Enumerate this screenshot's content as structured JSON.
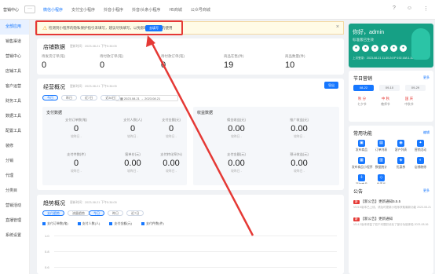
{
  "header": {
    "brand": "营销中心",
    "grid_glyph": "···",
    "nav": [
      "微信小程序",
      "支付宝小程序",
      "抖音小程序",
      "抖音/头条小程序",
      "H5商城",
      "公众号商城"
    ],
    "icons": [
      "help-icon",
      "user-icon",
      "more-icon"
    ]
  },
  "sidebar": {
    "items": [
      "全部应用",
      "销售渠道",
      "营销中心",
      "店铺工具",
      "客户运营",
      "财务工具",
      "数据工具",
      "配置工具",
      "装修",
      "分销",
      "代理",
      "分类目",
      "营销活动",
      "直播管理",
      "系统设置"
    ]
  },
  "notice": {
    "text": "检测到小程序的隐私保护指引未填写，建议尽快填写，以免影响部分功能的使用",
    "button": "去填写"
  },
  "store_data": {
    "title": "店铺数据",
    "updated": "更新时间：2023-08-21 下午5:36:05",
    "stats": [
      {
        "label": "待发货订单(笔)",
        "value": "0"
      },
      {
        "label": "待付款订单(笔)",
        "value": "0"
      },
      {
        "label": "待付款订单(笔)",
        "value": "0"
      },
      {
        "label": "商品在售(件)",
        "value": "19"
      },
      {
        "label": "商品数量(件)",
        "value": "10"
      }
    ]
  },
  "overview": {
    "title": "经营概况",
    "updated": "更新时间：2023-08-21 下午5:36:05",
    "tabs": [
      "今日",
      "昨日",
      "近7日",
      "近30日"
    ],
    "date_from": "2023.08.21",
    "date_to": "2023.08.21",
    "export": "导出",
    "pay_panel": {
      "title": "支付数据",
      "metrics": [
        {
          "label": "支付订单数(笔)",
          "value": "0",
          "compare": "较昨日 -"
        },
        {
          "label": "支付人数(人)",
          "value": "0",
          "compare": "较昨日 -"
        },
        {
          "label": "支付金额(元)",
          "value": "0",
          "compare": "较昨日 -"
        },
        {
          "label": "支付件数(件)",
          "value": "0",
          "compare": "较昨日 -"
        },
        {
          "label": "客单价(元)",
          "value": "0.00",
          "compare": "较昨日 -"
        },
        {
          "label": "支付转化率(%)",
          "value": "0.00",
          "compare": "较昨日 -"
        }
      ]
    },
    "profit_panel": {
      "title": "收益数据",
      "metrics": [
        {
          "label": "佣金收益(元)",
          "value": "0.00",
          "compare": "较昨日 -"
        },
        {
          "label": "推广收益(元)",
          "value": "0.00",
          "compare": "较昨日 -"
        },
        {
          "label": "支付金额(元)",
          "value": "0.00",
          "compare": "较昨日 -"
        },
        {
          "label": "预计收益(元)",
          "value": "0.00",
          "compare": "较昨日 -"
        }
      ]
    }
  },
  "trend": {
    "title": "趋势概况",
    "updated": "更新时间：2023-08-21 下午5:36:05",
    "modes": [
      "支付趋势",
      "流量趋势"
    ],
    "tabs": [
      "今日",
      "昨日",
      "近7日"
    ],
    "legend": [
      "支付订单数(笔)",
      "支付人数(人)",
      "支付金额(元)",
      "支付件数(件)"
    ],
    "y_ticks": [
      "1.0",
      "0.8",
      "0.6"
    ]
  },
  "profile": {
    "name": "你好，admin",
    "version": "标准版已生效",
    "meta": "上次登录：2023-08-21 11:30:24  IP:192.168.1.101"
  },
  "holiday": {
    "title": "节日营销",
    "link": "更多",
    "dates": [
      "08-22",
      "09-10",
      "09-29"
    ],
    "cells": [
      {
        "big": "秋 分",
        "small": "七夕节"
      },
      {
        "big": "中 秋",
        "small": "教师节"
      },
      {
        "big": "国 庆",
        "small": "中秋节"
      }
    ]
  },
  "functions": {
    "title": "常用功能",
    "link": "编辑",
    "items": [
      "发布商品",
      "订单列表",
      "客户列表",
      "营销活动",
      "发布商品小程序",
      "数据统计",
      "优惠券",
      "店铺装修",
      "添加商品",
      "优惠券"
    ]
  },
  "announcements": {
    "title": "公告",
    "link": "更多",
    "items": [
      {
        "tag": "新",
        "title": "【新公告】更新通知5.5.5",
        "desc": "V5.5.5版本已上线，请及时更新小程序获取最新功能 2023-08-21"
      },
      {
        "tag": "新",
        "title": "【新公告】更新通知",
        "desc": "V5.4.2版本修复了若干问题并优化了部分功能体验 2023-08-06"
      }
    ]
  }
}
